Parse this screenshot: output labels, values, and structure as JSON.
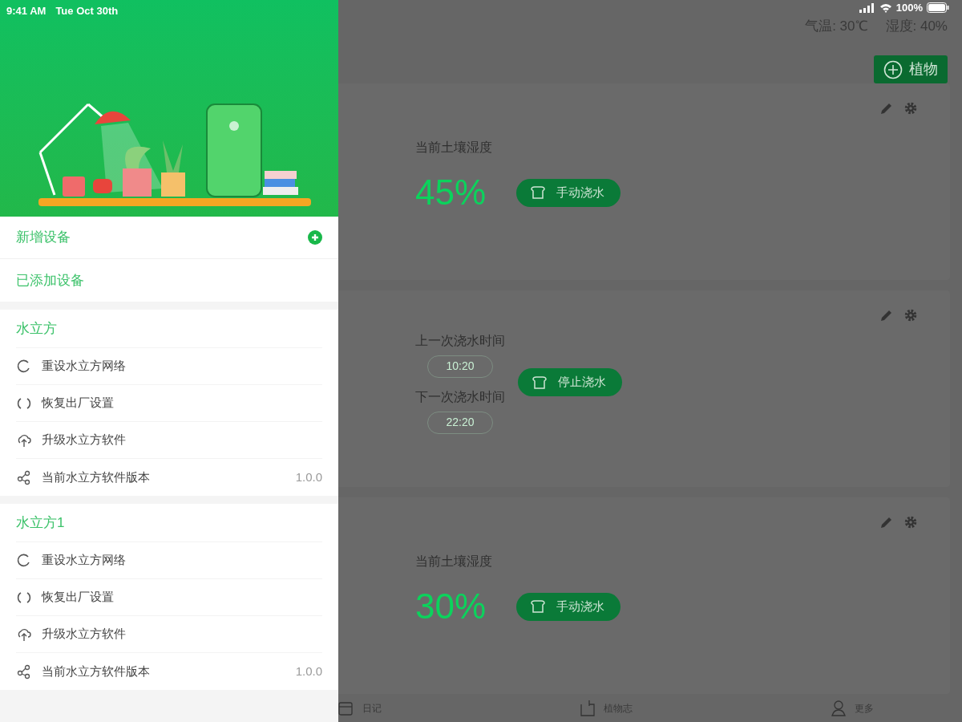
{
  "drawer": {
    "status_time": "9:41 AM",
    "status_date": "Tue Oct 30th",
    "add_device": {
      "label": "新增设备"
    },
    "added_devices_title": "已添加设备",
    "devices": [
      {
        "name": "水立方",
        "items": [
          {
            "kind": "reset",
            "label": "重设水立方网络"
          },
          {
            "kind": "restore",
            "label": "恢复出厂设置"
          },
          {
            "kind": "upgrade",
            "label": "升级水立方软件"
          },
          {
            "kind": "version",
            "label": "当前水立方软件版本",
            "value": "1.0.0"
          }
        ]
      },
      {
        "name": "水立方1",
        "items": [
          {
            "kind": "reset",
            "label": "重设水立方网络"
          },
          {
            "kind": "restore",
            "label": "恢复出厂设置"
          },
          {
            "kind": "upgrade",
            "label": "升级水立方软件"
          },
          {
            "kind": "version",
            "label": "当前水立方软件版本",
            "value": "1.0.0"
          }
        ]
      }
    ]
  },
  "status_bar": {
    "battery": "100%"
  },
  "weather": {
    "temperature": "气温: 30℃",
    "humidity": "湿度: 40%"
  },
  "add_plant_button": "植物",
  "cards": [
    {
      "kind": "moisture",
      "label": "当前土壤湿度",
      "value": "45%",
      "button": "手动浇水"
    },
    {
      "kind": "schedule",
      "last_label": "上一次浇水时间",
      "last_time": "10:20",
      "next_label": "下一次浇水时间",
      "next_time": "22:20",
      "button": "停止浇水"
    },
    {
      "kind": "moisture",
      "label": "当前土壤湿度",
      "value": "30%",
      "button": "手动浇水"
    }
  ],
  "bottom_tabs": [
    {
      "kind": "diary",
      "label": "日记"
    },
    {
      "kind": "book",
      "label": "植物志"
    },
    {
      "kind": "more",
      "label": "更多"
    }
  ]
}
